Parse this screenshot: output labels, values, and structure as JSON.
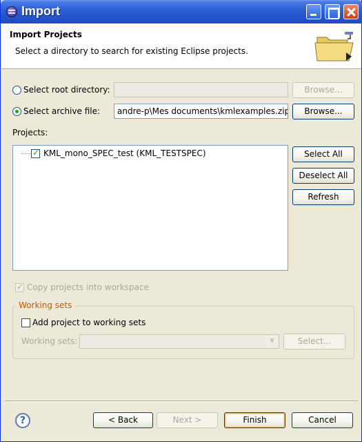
{
  "window": {
    "title": "Import"
  },
  "header": {
    "title": "Import Projects",
    "description": "Select a directory to search for existing Eclipse projects."
  },
  "source": {
    "root_directory_label": "Select root directory:",
    "root_directory_value": "",
    "root_browse_label": "Browse...",
    "archive_file_label": "Select archive file:",
    "archive_file_value": "andre-p\\Mes documents\\kmlexamples.zip",
    "archive_browse_label": "Browse..."
  },
  "projects": {
    "label": "Projects:",
    "items": [
      {
        "label": "KML_mono_SPEC_test (KML_TESTSPEC)",
        "checked": true
      }
    ],
    "select_all_label": "Select All",
    "deselect_all_label": "Deselect All",
    "refresh_label": "Refresh"
  },
  "options": {
    "copy_into_workspace_label": "Copy projects into workspace",
    "copy_into_workspace_checked": true
  },
  "working_sets": {
    "group_title": "Working sets",
    "add_to_working_sets_label": "Add project to working sets",
    "working_sets_label": "Working sets:",
    "select_label": "Select..."
  },
  "footer": {
    "back_label": "< Back",
    "next_label": "Next >",
    "finish_label": "Finish",
    "cancel_label": "Cancel",
    "help_glyph": "?"
  },
  "colors": {
    "titlebar": "#2454cb",
    "dialog_background": "#ece9d8",
    "group_title": "#c15d00",
    "check": "#21a121"
  }
}
